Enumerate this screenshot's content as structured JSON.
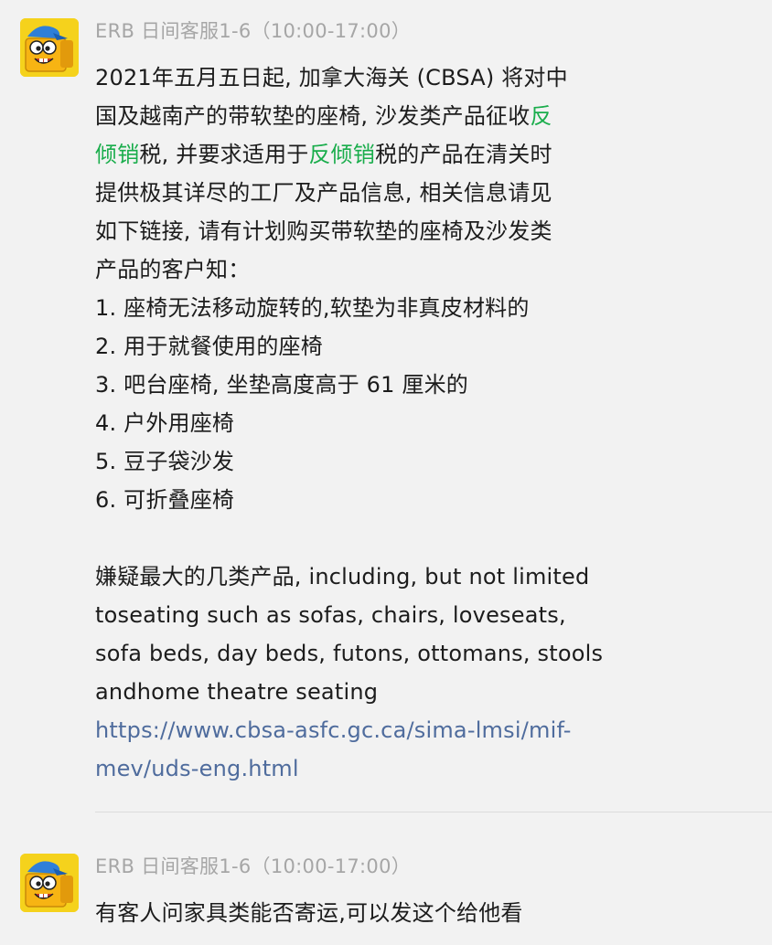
{
  "messages": [
    {
      "sender": "ERB 日间客服1-6（10:00-17:00）",
      "lines": [
        [
          {
            "t": "2021年五月五日起, 加拿大海关 (CBSA) 将对中"
          }
        ],
        [
          {
            "t": "国及越南产的带软垫的座椅, 沙发类产品征收"
          },
          {
            "t": "反",
            "c": "hl"
          }
        ],
        [
          {
            "t": "倾销",
            "c": "hl"
          },
          {
            "t": "税, 并要求适用于"
          },
          {
            "t": "反倾销",
            "c": "hl"
          },
          {
            "t": "税的产品在清关时"
          }
        ],
        [
          {
            "t": "提供极其详尽的工厂及产品信息, 相关信息请见"
          }
        ],
        [
          {
            "t": "如下链接, 请有计划购买带软垫的座椅及沙发类"
          }
        ],
        [
          {
            "t": "产品的客户知："
          }
        ],
        [
          {
            "t": "1. 座椅无法移动旋转的,软垫为非真皮材料的"
          }
        ],
        [
          {
            "t": "2. 用于就餐使用的座椅"
          }
        ],
        [
          {
            "t": "3. 吧台座椅, 坐垫高度高于 61 厘米的"
          }
        ],
        [
          {
            "t": "4. 户外用座椅"
          }
        ],
        [
          {
            "t": "5. 豆子袋沙发"
          }
        ],
        [
          {
            "t": "6. 可折叠座椅"
          }
        ],
        [],
        [
          {
            "t": "嫌疑最大的几类产品, including, but not limited"
          }
        ],
        [
          {
            "t": "toseating such as sofas, chairs, loveseats,"
          }
        ],
        [
          {
            "t": "sofa beds, day beds, futons, ottomans, stools"
          }
        ],
        [
          {
            "t": "andhome theatre seating"
          }
        ],
        [
          {
            "t": "https://www.cbsa-asfc.gc.ca/sima-lmsi/mif-",
            "c": "link"
          }
        ],
        [
          {
            "t": "mev/uds-eng.html",
            "c": "link"
          }
        ]
      ]
    },
    {
      "sender": "ERB 日间客服1-6（10:00-17:00）",
      "lines": [
        [
          {
            "t": "有客人问家具类能否寄运,可以发这个给他看"
          }
        ]
      ]
    }
  ],
  "colors": {
    "highlight": "#1aad4c",
    "link": "#4f6c9d",
    "background": "#f2f2f2"
  },
  "icons": {
    "avatar": "cartoon-box-mascot-icon"
  }
}
